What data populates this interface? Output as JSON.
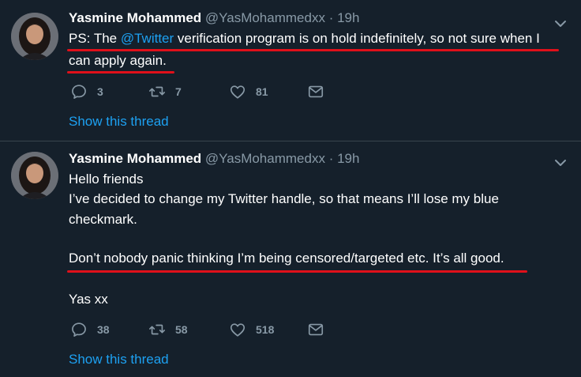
{
  "tweets": [
    {
      "name": "Yasmine Mohammed",
      "handle": "@YasMohammedxx",
      "separator": "·",
      "time": "19h",
      "line1_pre": "PS: The ",
      "line1_mention": "@Twitter",
      "line1_post": " verification program is on hold indefinitely, so not sure when I",
      "line2": "can apply again.",
      "replies": "3",
      "retweets": "7",
      "likes": "81",
      "show_thread": "Show this thread"
    },
    {
      "name": "Yasmine Mohammed",
      "handle": "@YasMohammedxx",
      "separator": "·",
      "time": "19h",
      "line1": "Hello friends",
      "line2": "I’ve decided to change my Twitter handle, so that means I’ll lose my blue",
      "line3": "checkmark.",
      "line4": "Don’t nobody panic thinking I’m being censored/targeted etc. It’s all good.",
      "line5": "Yas xx",
      "replies": "38",
      "retweets": "58",
      "likes": "518",
      "show_thread": "Show this thread"
    }
  ],
  "icons": [
    "chevron-down-icon",
    "reply-icon",
    "retweet-icon",
    "like-icon",
    "dm-icon"
  ],
  "colors": {
    "background": "#15202b",
    "link": "#1da1f2",
    "muted": "#8899a6",
    "annotation": "#e0101a"
  }
}
